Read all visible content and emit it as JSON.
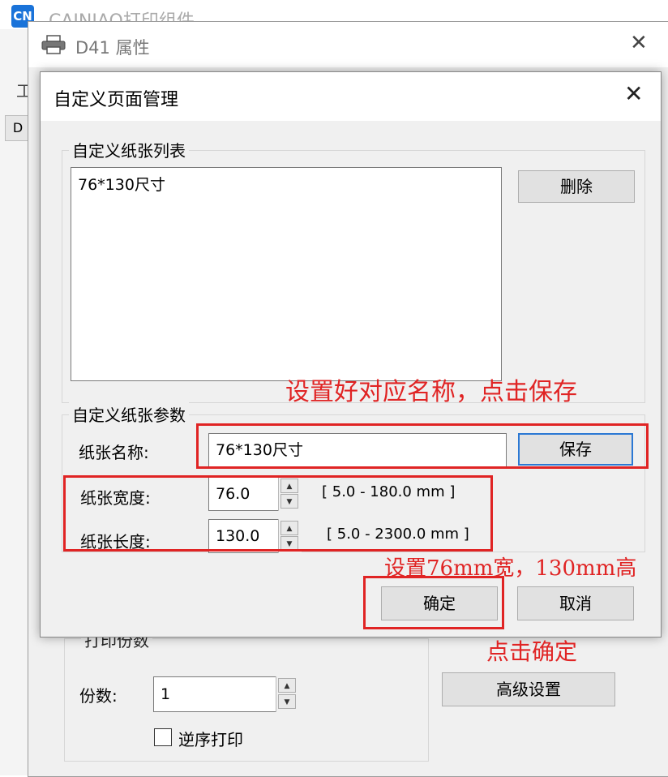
{
  "app": {
    "logo_text": "CN",
    "title": "CAINIAO打印组件",
    "left_char": "工",
    "left_tab": "D"
  },
  "props_window": {
    "title": "D41 属性",
    "close_glyph": "✕",
    "copies_group": {
      "legend": "打印份数",
      "copies_label": "份数:",
      "copies_value": "1",
      "reverse_label": "逆序打印",
      "reverse_checked": false
    },
    "advanced_button": "高级设置"
  },
  "dialog": {
    "title": "自定义页面管理",
    "close_glyph": "✕",
    "list_group": {
      "legend": "自定义纸张列表",
      "items": [
        "76*130尺寸"
      ],
      "delete_button": "删除"
    },
    "params_group": {
      "legend": "自定义纸张参数",
      "name_label": "纸张名称:",
      "name_value": "76*130尺寸",
      "save_button": "保存",
      "width_label": "纸张宽度:",
      "width_value": "76.0",
      "width_range": "[ 5.0 - 180.0 mm ]",
      "length_label": "纸张长度:",
      "length_value": "130.0",
      "length_range": "[ 5.0 - 2300.0 mm ]"
    },
    "ok_button": "确定",
    "cancel_button": "取消"
  },
  "annotations": {
    "note_save": "设置好对应名称，点击保存",
    "note_size": "设置76mm宽，130mm高",
    "note_ok": "点击确定",
    "color": "#e02424"
  },
  "icons": {
    "up_arrow": "▲",
    "down_arrow": "▼"
  }
}
